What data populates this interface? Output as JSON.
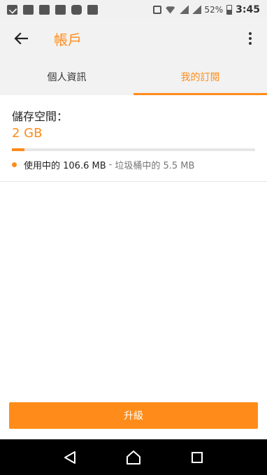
{
  "status_bar": {
    "battery": "52%",
    "time": "3:45"
  },
  "app_bar": {
    "title": "帳戶"
  },
  "tabs": [
    {
      "label": "個人資訊",
      "active": false
    },
    {
      "label": "我的訂閱",
      "active": true
    }
  ],
  "storage": {
    "label": "儲存空間：",
    "total": "2 GB",
    "used_text": "使用中的 106.6 MB",
    "separator": "-",
    "trash_text": "垃圾桶中的 5.5 MB",
    "used_fraction": 0.053
  },
  "upgrade_button": {
    "label": "升級"
  },
  "colors": {
    "accent": "#ff8c1a",
    "bar_bg": "#f2f2f2"
  }
}
